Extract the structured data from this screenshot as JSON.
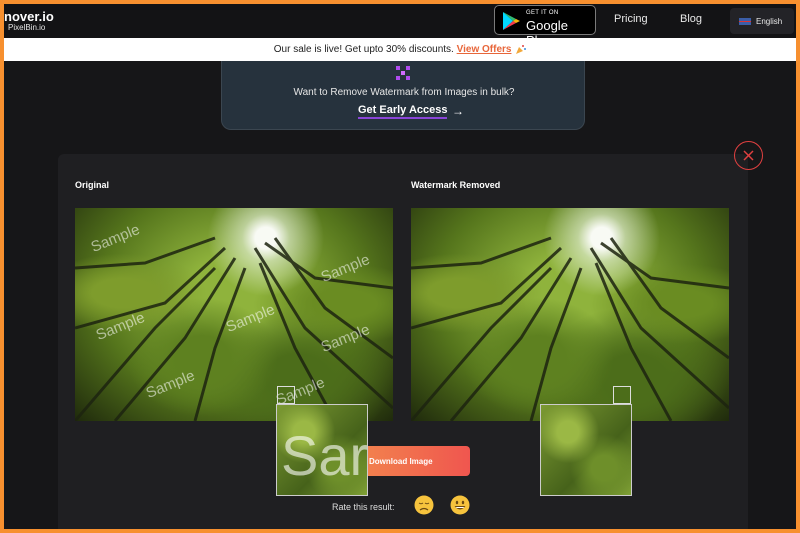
{
  "nav": {
    "logo_main": "nover.io",
    "logo_sub": "PixelBin.io",
    "gplay_top": "GET IT ON",
    "gplay_main": "Google Play",
    "pricing": "Pricing",
    "blog": "Blog",
    "language": "English"
  },
  "sale": {
    "text": "Our sale is live! Get upto 30% discounts.",
    "link": "View Offers"
  },
  "bulk": {
    "question": "Want to Remove Watermark from Images in bulk?",
    "cta": "Get Early Access",
    "cta_arrow": "→"
  },
  "result": {
    "original_label": "Original",
    "removed_label": "Watermark Removed",
    "watermark_text": "Sample",
    "zoom_text": "Sar",
    "download_label": "Download Image",
    "rate_label": "Rate this result:"
  },
  "icons": {
    "pixelbin_icon": "pixelbin-logo",
    "close_icon": "close-icon",
    "sad_icon": "sad-face-emoji",
    "happy_icon": "happy-face-emoji"
  },
  "colors": {
    "accent": "#e8663a",
    "underline": "#8a45d8",
    "close": "#e04040"
  }
}
